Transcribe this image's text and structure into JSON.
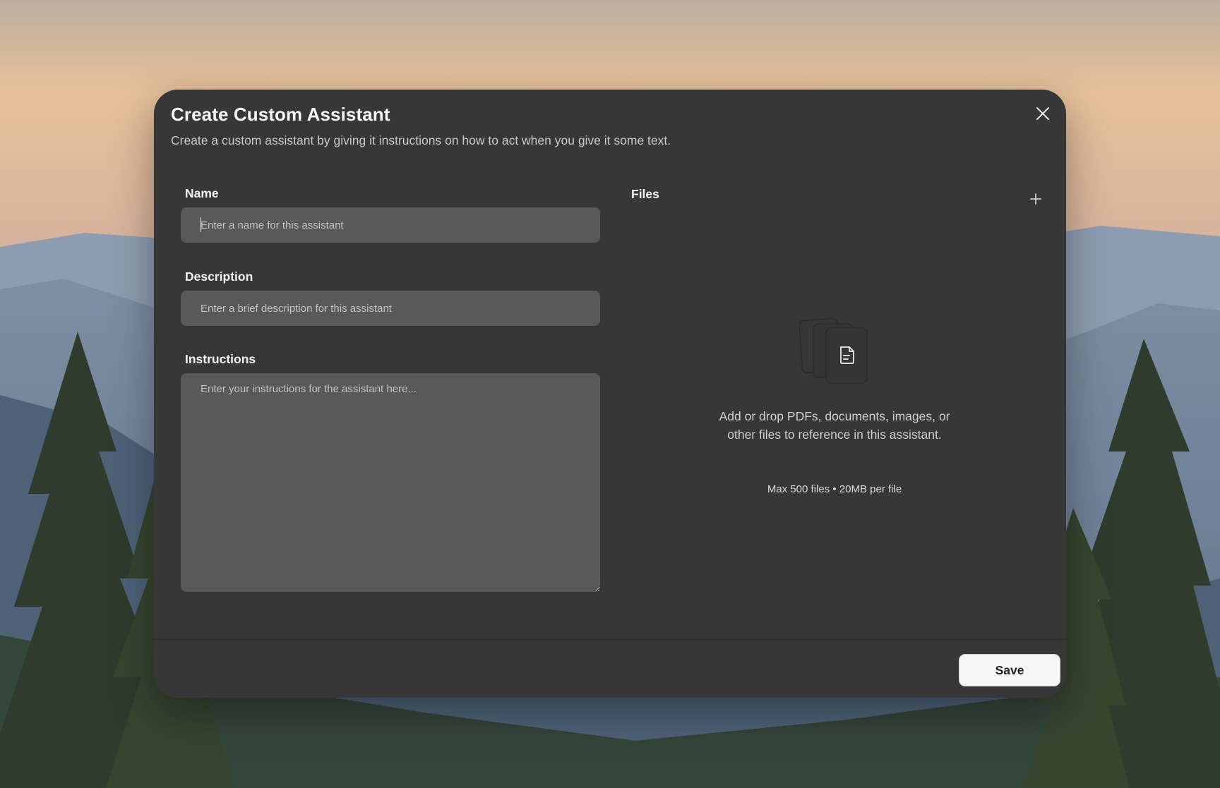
{
  "dialog": {
    "title": "Create Custom Assistant",
    "subtitle": "Create a custom assistant by giving it instructions on how to act when you give it some text.",
    "close_icon": "close-icon"
  },
  "form": {
    "name": {
      "label": "Name",
      "value": "",
      "placeholder": "Enter a name for this assistant"
    },
    "description": {
      "label": "Description",
      "value": "",
      "placeholder": "Enter a brief description for this assistant"
    },
    "instructions": {
      "label": "Instructions",
      "value": "",
      "placeholder": "Enter your instructions for the assistant here..."
    }
  },
  "files": {
    "label": "Files",
    "add_icon": "plus-icon",
    "empty_icon": "stacked-documents-icon",
    "empty_text": "Add or drop PDFs, documents, images, or other files to reference in this assistant.",
    "limits": "Max 500 files • 20MB per file"
  },
  "footer": {
    "save_label": "Save"
  },
  "colors": {
    "dialog_bg": "#373737",
    "field_bg": "#595959",
    "button_bg": "#f6f6f6"
  }
}
